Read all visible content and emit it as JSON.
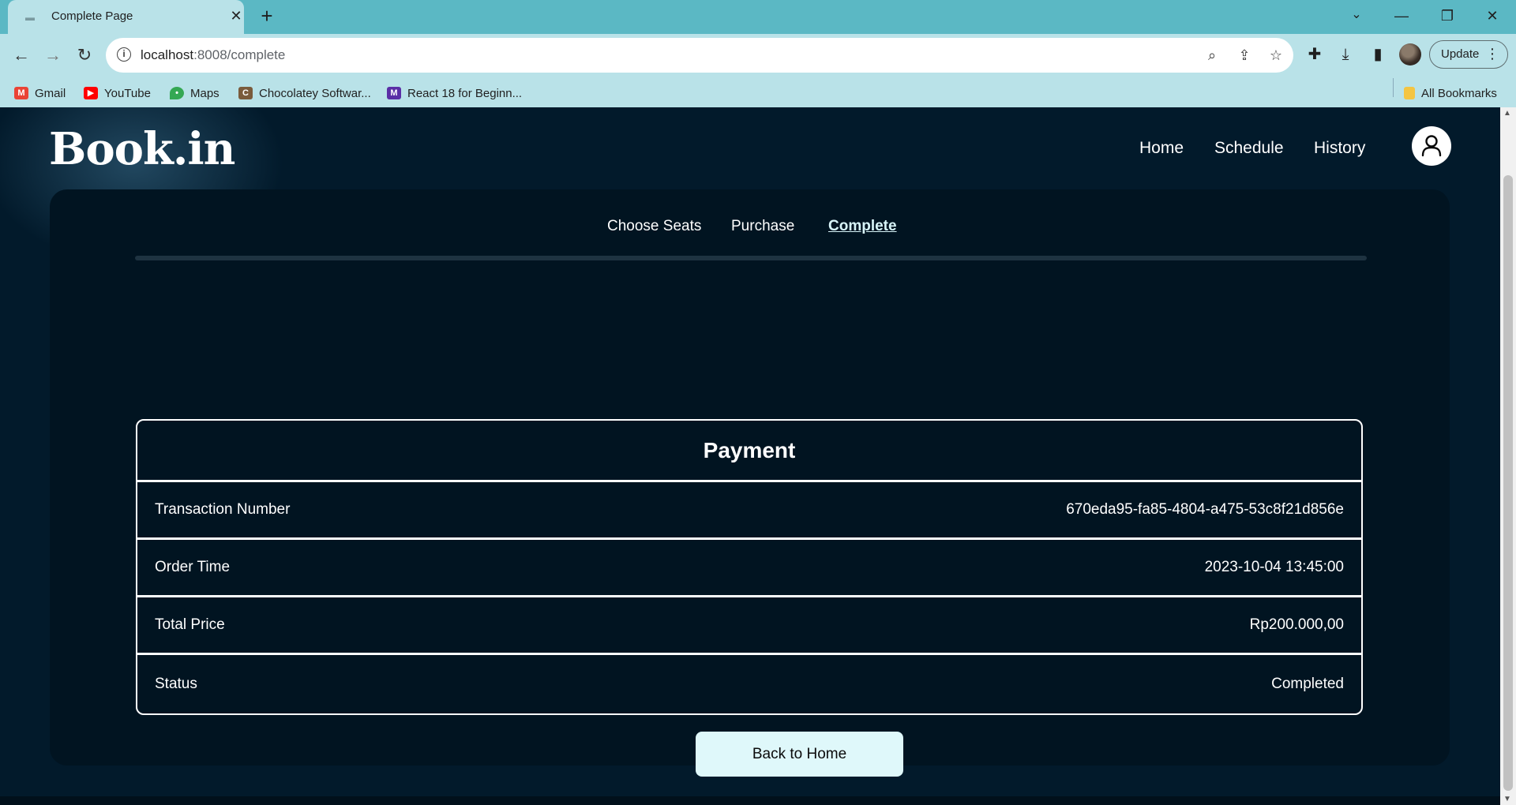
{
  "browser": {
    "tab_title": "Complete Page",
    "url_host": "localhost",
    "url_path": ":8008/complete",
    "update_label": "Update",
    "bookmarks": [
      {
        "label": "Gmail",
        "icon": "gmail-icon",
        "color": "#ea4335"
      },
      {
        "label": "YouTube",
        "icon": "youtube-icon",
        "color": "#ff0000"
      },
      {
        "label": "Maps",
        "icon": "maps-icon",
        "color": "#34a853"
      },
      {
        "label": "Chocolatey Softwar...",
        "icon": "chocolatey-icon",
        "color": "#7a5b3c"
      },
      {
        "label": "React 18 for Beginn...",
        "icon": "react-course-icon",
        "color": "#5a2ea6"
      }
    ],
    "all_bookmarks_label": "All Bookmarks"
  },
  "site": {
    "logo": "Book.in",
    "nav": {
      "home": "Home",
      "schedule": "Schedule",
      "history": "History"
    }
  },
  "steps": {
    "choose_seats": "Choose Seats",
    "purchase": "Purchase",
    "complete": "Complete",
    "active": "Complete"
  },
  "payment": {
    "title": "Payment",
    "rows": [
      {
        "label": "Transaction Number",
        "value": "670eda95-fa85-4804-a475-53c8f21d856e"
      },
      {
        "label": "Order Time",
        "value": "2023-10-04 13:45:00"
      },
      {
        "label": "Total Price",
        "value": "Rp200.000,00"
      },
      {
        "label": "Status",
        "value": "Completed"
      }
    ]
  },
  "back_button": "Back to Home",
  "colors": {
    "background": "#021a2b",
    "card": "#011421",
    "button": "#dff8fa",
    "browser_frame": "#5bb8c4",
    "browser_toolbar": "#b9e2e8"
  }
}
